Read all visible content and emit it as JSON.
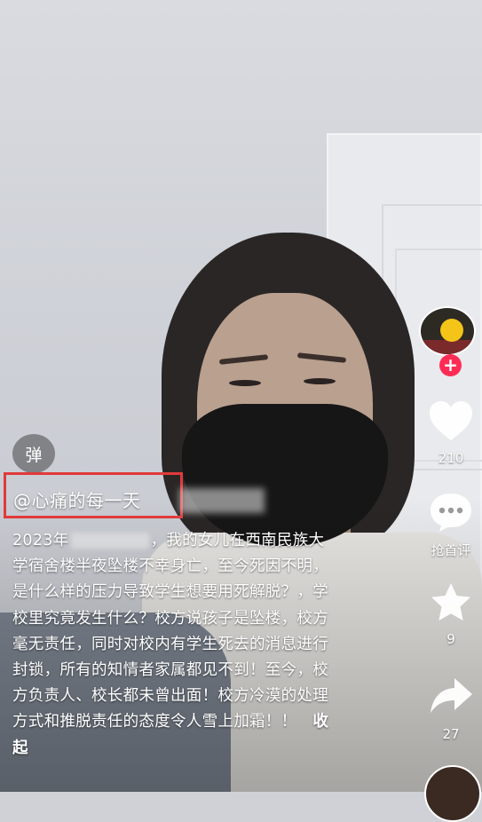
{
  "overlay": {
    "danmu_label": "弹",
    "author_handle": "@心痛的每一天",
    "description_part1": "2023年",
    "description_part2": "，我的女儿在西南民族大学宿舍楼半夜坠楼不幸身亡，至今死因不明，是什么样的压力导致学生想要用死解脱？，学校里究竟发生什么？校方说孩子是坠楼，校方毫无责任，同时对校内有学生死去的消息进行封锁，所有的知情者家属都见不到！至今，校方负责人、校长都未曾出面！校方冷漠的处理方式和推脱责任的态度令人雪上加霜！！",
    "collapse_label": "收起"
  },
  "actions": {
    "follow_label": "+",
    "like_count": "210",
    "comment_label": "抢首评",
    "favorite_count": "9",
    "share_count": "27"
  },
  "colors": {
    "highlight_box": "#e03a3a",
    "follow_accent": "#fe2c55",
    "text": "#ffffff"
  }
}
